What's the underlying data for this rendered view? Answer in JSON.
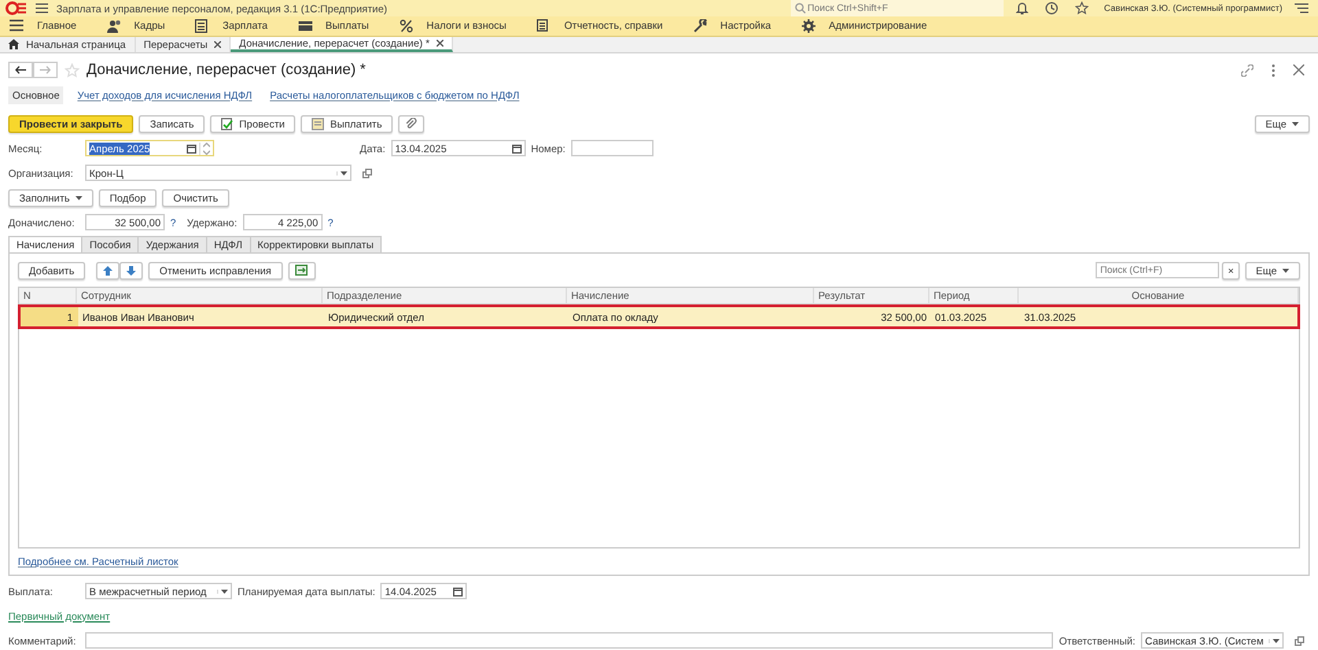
{
  "window": {
    "title": "Зарплата и управление персоналом, редакция 3.1  (1С:Предприятие)",
    "search_placeholder": "Поиск Ctrl+Shift+F",
    "user": "Савинская З.Ю. (Системный программист)"
  },
  "menu": [
    "Главное",
    "Кадры",
    "Зарплата",
    "Выплаты",
    "Налоги и взносы",
    "Отчетность, справки",
    "Настройка",
    "Администрирование"
  ],
  "open_tabs": [
    {
      "label": "Начальная страница",
      "selected": false,
      "closable": false,
      "home": true
    },
    {
      "label": "Перерасчеты",
      "selected": false,
      "closable": true,
      "home": false
    },
    {
      "label": "Доначисление, перерасчет (создание) *",
      "selected": true,
      "closable": true,
      "home": false
    }
  ],
  "form": {
    "title": "Доначисление, перерасчет (создание) *",
    "sections": [
      {
        "label": "Основное",
        "selected": true
      },
      {
        "label": "Учет доходов для исчисления НДФЛ",
        "selected": false
      },
      {
        "label": "Расчеты налогоплательщиков с бюджетом по НДФЛ",
        "selected": false
      }
    ],
    "toolbar": [
      {
        "label": "Провести и закрыть",
        "kind": "primary"
      },
      {
        "label": "Записать",
        "kind": "plain"
      },
      {
        "label": "Провести",
        "kind": "post"
      },
      {
        "label": "Выплатить",
        "kind": "pay"
      },
      {
        "kind": "clip"
      }
    ],
    "more": "Еще",
    "month": {
      "label": "Месяц:",
      "value": "Апрель 2025"
    },
    "date": {
      "label": "Дата:",
      "value": "13.04.2025"
    },
    "number": {
      "label": "Номер:"
    },
    "organization": {
      "label": "Организация:",
      "value": "Крон-Ц"
    },
    "fill_buttons": [
      {
        "label": "Заполнить",
        "dropdown": true
      },
      {
        "label": "Подбор",
        "dropdown": false
      },
      {
        "label": "Очистить",
        "dropdown": false
      }
    ],
    "accrued": {
      "label": "Доначислено:",
      "value": "32 500,00",
      "hint": "?"
    },
    "withheld": {
      "label": "Удержано:",
      "value": "4 225,00",
      "hint": "?"
    },
    "tabs": [
      {
        "label": "Начисления",
        "selected": true
      },
      {
        "label": "Пособия",
        "selected": false
      },
      {
        "label": "Удержания",
        "selected": false
      },
      {
        "label": "НДФЛ",
        "selected": false
      },
      {
        "label": "Корректировки выплаты",
        "selected": false
      }
    ],
    "table_toolbar": {
      "add": "Добавить",
      "cancel": "Отменить исправления",
      "search_placeholder": "Поиск (Ctrl+F)",
      "clear": "×",
      "more": "Еще"
    },
    "table": {
      "columns": [
        "N",
        "Сотрудник",
        "Подразделение",
        "Начисление",
        "Результат",
        "Период",
        "Основание"
      ],
      "rows": [
        {
          "cells": [
            "1",
            "Иванов Иван Иванович",
            "Юридический отдел",
            "Оплата по окладу",
            "32 500,00",
            "01.03.2025",
            "31.03.2025"
          ],
          "selected": true,
          "highlighted": true
        }
      ]
    },
    "details_link": "Подробнее см. Расчетный листок",
    "payment": {
      "label": "Выплата:",
      "value": "В межрасчетный период",
      "planned_label": "Планируемая дата выплаты:",
      "planned_value": "14.04.2025"
    },
    "primary_doc_link": "Первичный документ",
    "comment": {
      "label": "Комментарий:"
    },
    "responsible": {
      "label": "Ответственный:",
      "value": "Савинская З.Ю. (Систем"
    }
  }
}
